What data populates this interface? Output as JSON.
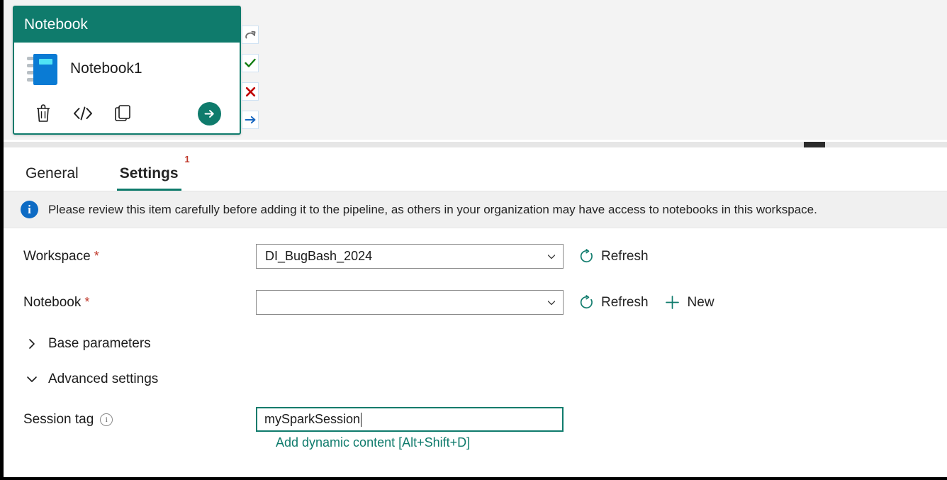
{
  "activity_card": {
    "type_label": "Notebook",
    "name": "Notebook1",
    "icon": "notebook-icon",
    "actions": [
      {
        "name": "delete-activity-button",
        "icon": "trash-icon"
      },
      {
        "name": "view-code-button",
        "icon": "code-icon"
      },
      {
        "name": "duplicate-activity-button",
        "icon": "copy-icon"
      }
    ],
    "run_button": {
      "name": "run-activity-button",
      "icon": "arrow-right-icon"
    },
    "connectors": [
      {
        "name": "on-skip-connector",
        "icon": "retry-arrow-icon"
      },
      {
        "name": "on-success-connector",
        "icon": "checkmark-icon"
      },
      {
        "name": "on-failure-connector",
        "icon": "cross-icon"
      },
      {
        "name": "on-completion-connector",
        "icon": "arrow-right-icon"
      }
    ]
  },
  "tabs": [
    {
      "label": "General",
      "active": false,
      "badge": ""
    },
    {
      "label": "Settings",
      "active": true,
      "badge": "1"
    }
  ],
  "info_bar": {
    "icon": "info-icon",
    "message": "Please review this item carefully before adding it to the pipeline, as others in your organization may have access to notebooks in this workspace."
  },
  "form": {
    "workspace": {
      "label": "Workspace",
      "required": "*",
      "value": "DI_BugBash_2024",
      "placeholder": "",
      "refresh_label": "Refresh"
    },
    "notebook": {
      "label": "Notebook",
      "required": "*",
      "value": "",
      "placeholder": "",
      "refresh_label": "Refresh",
      "new_label": "New"
    },
    "base_parameters": {
      "label": "Base parameters",
      "expanded": false
    },
    "advanced_settings": {
      "label": "Advanced settings",
      "expanded": true
    },
    "session_tag": {
      "label": "Session tag",
      "value": "mySparkSession",
      "placeholder": "",
      "dynamic_content_link": "Add dynamic content [Alt+Shift+D]"
    }
  },
  "colors": {
    "accent_teal": "#0f7b6c",
    "notebook_blue": "#0a7bd4",
    "required_red": "#c0392b",
    "info_blue": "#0d6bc4",
    "success_green": "#107c10",
    "failure_red": "#c00000",
    "connector_blue": "#1565c0"
  }
}
